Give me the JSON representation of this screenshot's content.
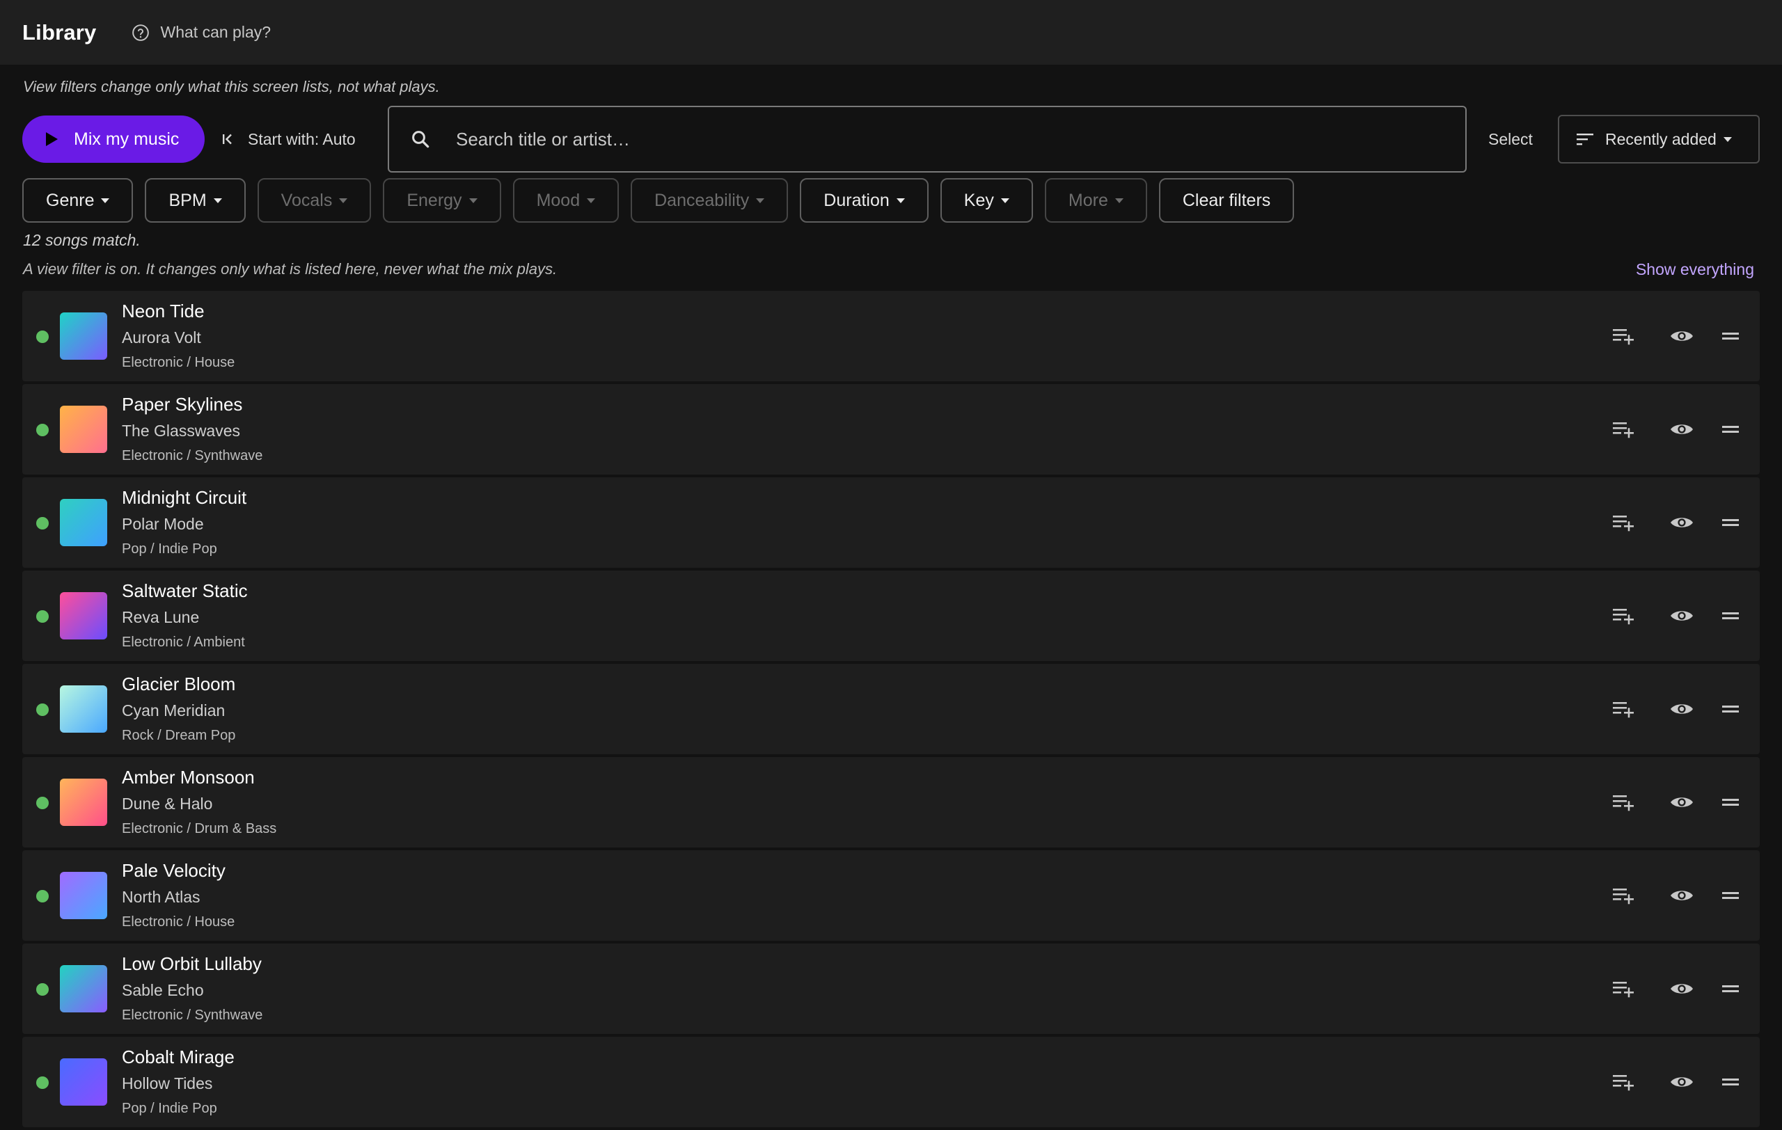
{
  "app": {
    "title": "Library",
    "help_label": "What can play?"
  },
  "hint": "View filters change only what this screen lists, not what plays.",
  "toolbar": {
    "mix_label": "Mix my music",
    "start_with_label": "Start with: Auto",
    "search_placeholder": "Search title or artist…",
    "select_label": "Select",
    "sort_label": "Recently added"
  },
  "filters": [
    {
      "label": "Genre",
      "enabled": true
    },
    {
      "label": "BPM",
      "enabled": true
    },
    {
      "label": "Vocals",
      "enabled": false
    },
    {
      "label": "Energy",
      "enabled": false
    },
    {
      "label": "Mood",
      "enabled": false
    },
    {
      "label": "Danceability",
      "enabled": false
    },
    {
      "label": "Duration",
      "enabled": true
    },
    {
      "label": "Key",
      "enabled": true
    },
    {
      "label": "More",
      "enabled": false
    }
  ],
  "clear_filters_label": "Clear filters",
  "count_text": "12 songs match.",
  "filter_note": "A view filter is on. It changes only what is listed here, never what the mix plays.",
  "show_everything_label": "Show everything",
  "colors": {
    "accent": "#6a1be6",
    "status_dot": "#5fbf62",
    "link": "#c3a6ff"
  },
  "songs": [
    {
      "title": "Neon Tide",
      "artist": "Aurora Volt",
      "genre": "Electronic / House",
      "art": [
        "#1fd3c6",
        "#7a5cff"
      ]
    },
    {
      "title": "Paper Skylines",
      "artist": "The Glasswaves",
      "genre": "Electronic / Synthwave",
      "art": [
        "#ffb347",
        "#ff6f8f"
      ]
    },
    {
      "title": "Midnight Circuit",
      "artist": "Polar Mode",
      "genre": "Pop / Indie Pop",
      "art": [
        "#2fd0c0",
        "#3fa0ff"
      ]
    },
    {
      "title": "Saltwater Static",
      "artist": "Reva Lune",
      "genre": "Electronic / Ambient",
      "art": [
        "#ff4f9a",
        "#6a4dff"
      ]
    },
    {
      "title": "Glacier Bloom",
      "artist": "Cyan Meridian",
      "genre": "Rock / Dream Pop",
      "art": [
        "#b8f7e0",
        "#4aa8ff"
      ]
    },
    {
      "title": "Amber Monsoon",
      "artist": "Dune & Halo",
      "genre": "Electronic / Drum & Bass",
      "art": [
        "#ffb55a",
        "#ff4f8a"
      ]
    },
    {
      "title": "Pale Velocity",
      "artist": "North Atlas",
      "genre": "Electronic / House",
      "art": [
        "#a06bff",
        "#4aa8ff"
      ]
    },
    {
      "title": "Low Orbit Lullaby",
      "artist": "Sable Echo",
      "genre": "Electronic / Synthwave",
      "art": [
        "#22d3c0",
        "#8a5cff"
      ]
    },
    {
      "title": "Cobalt Mirage",
      "artist": "Hollow Tides",
      "genre": "Pop / Indie Pop",
      "art": [
        "#4a6bff",
        "#8a4dff"
      ]
    }
  ]
}
